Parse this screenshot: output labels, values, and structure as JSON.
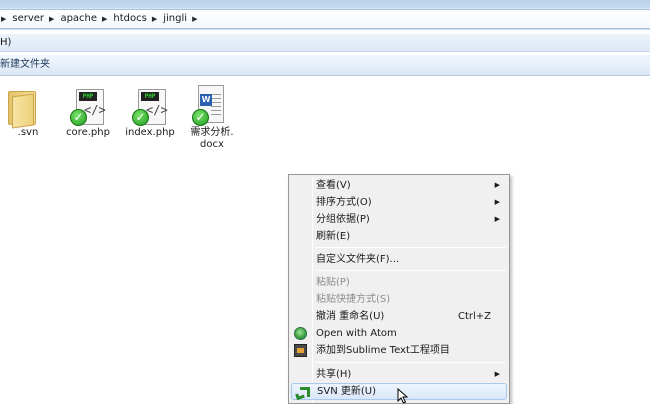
{
  "address_bar": {
    "crumbs": [
      "server",
      "apache",
      "htdocs",
      "jingli"
    ]
  },
  "menubar": {
    "partial_item": "H)"
  },
  "toolbar": {
    "new_folder_label": "新建文件夹"
  },
  "files": [
    {
      "name": ".svn",
      "icon": "folder-icon"
    },
    {
      "name": "core.php",
      "icon": "php-file-icon",
      "tag": "PHP",
      "glyph": "</>"
    },
    {
      "name": "index.php",
      "icon": "php-file-icon",
      "tag": "PHP",
      "glyph": "</>"
    },
    {
      "name_line1": "需求分析.",
      "name_line2": "docx",
      "icon": "word-file-icon",
      "tag": "W"
    }
  ],
  "context_menu": {
    "view": "查看(V)",
    "sort_by": "排序方式(O)",
    "group_by": "分组依据(P)",
    "refresh": "刷新(E)",
    "customize_folder": "自定义文件夹(F)...",
    "paste": "粘贴(P)",
    "paste_shortcut": "粘贴快捷方式(S)",
    "undo_rename": "撤消 重命名(U)",
    "undo_shortcut": "Ctrl+Z",
    "open_with_atom": "Open with Atom",
    "add_to_sublime": "添加到Sublime Text工程项目",
    "share_with": "共享(H)",
    "svn_update": "SVN 更新(U)"
  },
  "colors": {
    "menu_background": "#f0f0f0",
    "highlight": "#d9e7f8",
    "disabled_text": "#8d8d8d",
    "svn_check": "#1e9a1e"
  }
}
